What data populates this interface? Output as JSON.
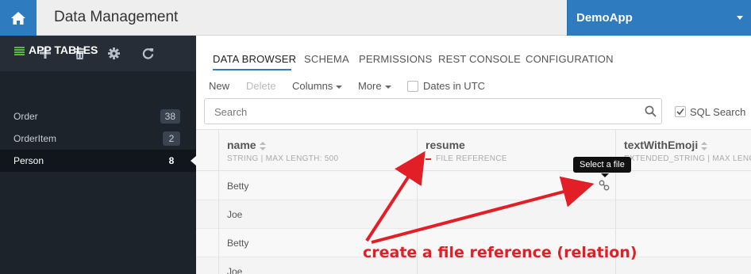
{
  "topbar": {
    "title": "Data Management",
    "app_name": "DemoApp"
  },
  "sidebar": {
    "header_label": "APP TABLES",
    "items": [
      {
        "label": "Order",
        "count": "38"
      },
      {
        "label": "OrderItem",
        "count": "2"
      },
      {
        "label": "Person",
        "count": "8"
      }
    ]
  },
  "tabs": [
    "DATA BROWSER",
    "SCHEMA",
    "PERMISSIONS",
    "REST CONSOLE",
    "CONFIGURATION"
  ],
  "toolbar": {
    "new_label": "New",
    "delete_label": "Delete",
    "columns_label": "Columns",
    "more_label": "More",
    "dates_utc_label": "Dates in UTC"
  },
  "search": {
    "placeholder": "Search",
    "sql_label": "SQL Search",
    "sql_checked": true
  },
  "grid": {
    "columns": [
      {
        "name": "name",
        "meta": "STRING | MAX LENGTH: 500"
      },
      {
        "name": "resume",
        "meta": "FILE REFERENCE"
      },
      {
        "name": "textWithEmoji",
        "meta": "EXTENDED_STRING | MAX LENG"
      }
    ],
    "rows": [
      {
        "name": "Betty"
      },
      {
        "name": "Joe"
      },
      {
        "name": "Betty"
      },
      {
        "name": "Joe"
      }
    ]
  },
  "tooltip": "Select a file",
  "annotation": "create a file reference (relation)",
  "colors": {
    "accent": "#2f7bbf",
    "annotation": "#e21f26",
    "sidebar": "#1d232b"
  }
}
